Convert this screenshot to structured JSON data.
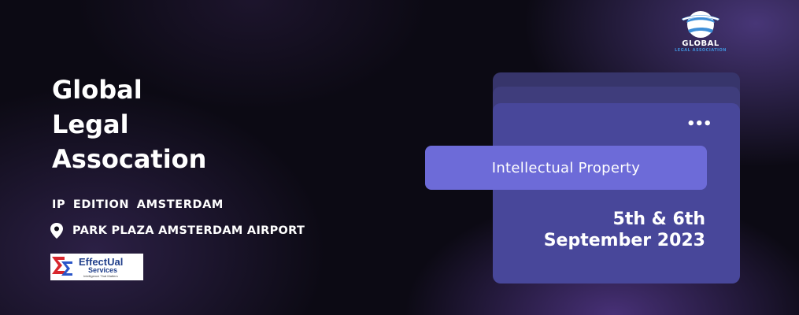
{
  "title": [
    "Global",
    "Legal",
    "Assocation"
  ],
  "edition": "IP  EDITION  AMSTERDAM",
  "venue": {
    "icon": "location-pin-icon",
    "text": "PARK PLAZA AMSTERDAM AIRPORT"
  },
  "sponsor": {
    "name": "EffectUal",
    "sub": "Services",
    "tagline": "Intelligence That Matters"
  },
  "logo": {
    "name": "GLOBAL",
    "sub": "LEGAL ASSOCIATION"
  },
  "card": {
    "menu_icon": "more-dots-icon",
    "topic": "Intellectual Property",
    "date_line1": "5th & 6th",
    "date_line2": "September 2023"
  },
  "colors": {
    "background": "#0c0a14",
    "card": "#48479a",
    "pill": "#6d6bd8",
    "logo_accent": "#3f8fd8"
  }
}
